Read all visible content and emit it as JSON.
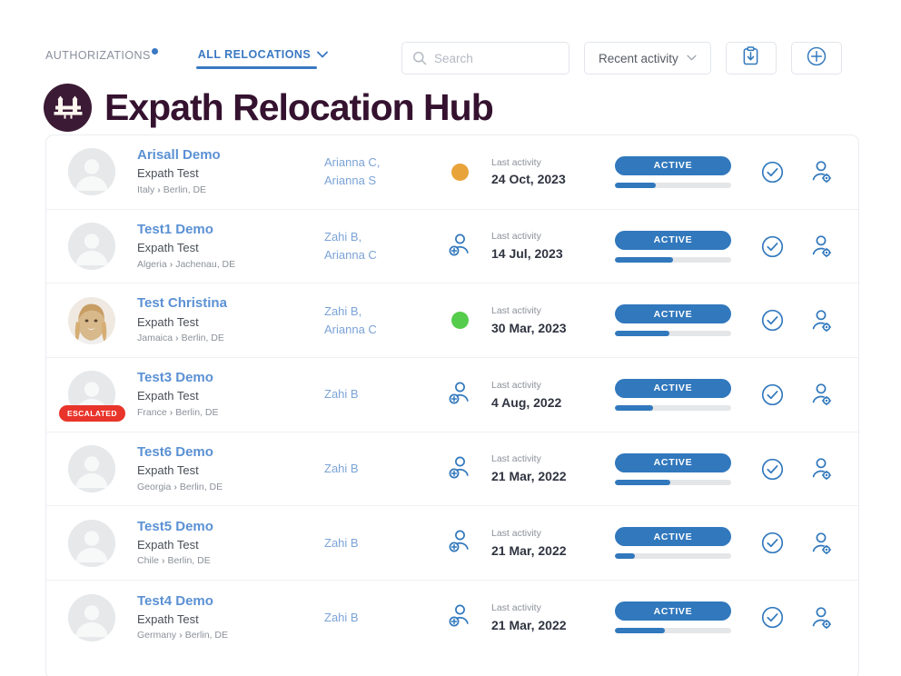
{
  "header": {
    "tabs": [
      {
        "label": "AUTHORIZATIONS",
        "active": false,
        "has_notification_dot": true,
        "has_caret": false
      },
      {
        "label": "ALL RELOCATIONS",
        "active": true,
        "has_notification_dot": false,
        "has_caret": true
      }
    ],
    "caret_glyph": "⌄"
  },
  "search": {
    "placeholder": "Search",
    "value": "",
    "icon": "search-icon",
    "filter_icon": "filter-sliders-icon"
  },
  "sort": {
    "label": "Recent activity",
    "caret": "⌄"
  },
  "buttons": {
    "export_icon": "clipboard-download-icon",
    "add_icon": "plus-circle-icon"
  },
  "title": {
    "text": "Expath Relocation Hub",
    "logo_icon": "brandenburg-gate-logo-icon",
    "logo_bg": "#3b1a35",
    "text_color": "#35122f"
  },
  "colors": {
    "accent_blue": "#3178bd",
    "name_blue": "#5b91d4",
    "assignee_blue": "#7ba3d6",
    "escalated_red": "#e8342a",
    "dot_orange": "#e8a33a",
    "dot_green": "#55cc4b",
    "track_grey": "#e4e6e8"
  },
  "labels": {
    "last_activity": "Last activity",
    "escalated": "ESCALATED",
    "status_active": "ACTIVE",
    "route_arrow": "›"
  },
  "rows": [
    {
      "name": "Arisall Demo",
      "org": "Expath Test",
      "from": "Italy",
      "to": "Berlin, DE",
      "assignees": "Arianna C,\nArianna S",
      "avatar_type": "placeholder",
      "escalated": false,
      "mark_type": "dot",
      "dot_color": "#e8a33a",
      "last_activity_label": "Last activity",
      "last_activity_date": "24 Oct, 2023",
      "status": "ACTIVE",
      "progress": 35
    },
    {
      "name": "Test1 Demo",
      "org": "Expath Test",
      "from": "Algeria",
      "to": "Jachenau, DE",
      "assignees": "Zahi B,\nArianna C",
      "avatar_type": "placeholder",
      "escalated": false,
      "mark_type": "person-add-icon",
      "dot_color": "",
      "last_activity_label": "Last activity",
      "last_activity_date": "14 Jul, 2023",
      "status": "ACTIVE",
      "progress": 50
    },
    {
      "name": "Test Christina",
      "org": "Expath Test",
      "from": "Jamaica",
      "to": "Berlin, DE",
      "assignees": "Zahi B,\nArianna C",
      "avatar_type": "photo",
      "escalated": false,
      "mark_type": "dot",
      "dot_color": "#55cc4b",
      "last_activity_label": "Last activity",
      "last_activity_date": "30 Mar, 2023",
      "status": "ACTIVE",
      "progress": 47
    },
    {
      "name": "Test3 Demo",
      "org": "Expath Test",
      "from": "France",
      "to": "Berlin, DE",
      "assignees": "Zahi B",
      "avatar_type": "placeholder",
      "escalated": true,
      "mark_type": "person-add-icon",
      "dot_color": "",
      "last_activity_label": "Last activity",
      "last_activity_date": "4 Aug, 2022",
      "status": "ACTIVE",
      "progress": 33
    },
    {
      "name": "Test6 Demo",
      "org": "Expath Test",
      "from": "Georgia",
      "to": "Berlin, DE",
      "assignees": "Zahi B",
      "avatar_type": "placeholder",
      "escalated": false,
      "mark_type": "person-add-icon",
      "dot_color": "",
      "last_activity_label": "Last activity",
      "last_activity_date": "21 Mar, 2022",
      "status": "ACTIVE",
      "progress": 48
    },
    {
      "name": "Test5 Demo",
      "org": "Expath Test",
      "from": "Chile",
      "to": "Berlin, DE",
      "assignees": "Zahi B",
      "avatar_type": "placeholder",
      "escalated": false,
      "mark_type": "person-add-icon",
      "dot_color": "",
      "last_activity_label": "Last activity",
      "last_activity_date": "21 Mar, 2022",
      "status": "ACTIVE",
      "progress": 17
    },
    {
      "name": "Test4 Demo",
      "org": "Expath Test",
      "from": "Germany",
      "to": "Berlin, DE",
      "assignees": "Zahi B",
      "avatar_type": "placeholder",
      "escalated": false,
      "mark_type": "person-add-icon",
      "dot_color": "",
      "last_activity_label": "Last activity",
      "last_activity_date": "21 Mar, 2022",
      "status": "ACTIVE",
      "progress": 43
    }
  ]
}
